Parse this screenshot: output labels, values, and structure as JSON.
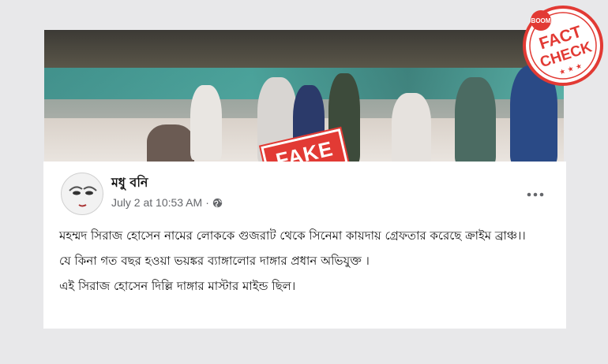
{
  "video": {
    "stamp_label": "FAKE"
  },
  "seal": {
    "top": "BOOM",
    "line1": "FACT",
    "line2": "CHECK",
    "stars": "★ ★ ★"
  },
  "post": {
    "author": "মধু বনি",
    "date": "July 2 at 10:53 AM",
    "separator": "·",
    "paragraphs": [
      "মহম্মদ  সিরাজ হোসেন  নামের লোককে গুজরাট থেকে সিনেমা কায়দায় গ্রেফতার করেছে ক্রাইম ব্রাঞ্চ।।",
      "যে কিনা  গত বছর হওয়া ভয়ঙ্কর  ব্যাঙ্গালোর দাঙ্গার প্রধান অভিযুক্ত ।",
      "এই সিরাজ হোসেন দিল্লি দাঙ্গার মাস্টার মাইন্ড ছিল।"
    ]
  },
  "colors": {
    "stamp": "#e23a34",
    "card": "#ffffff",
    "meta": "#65676b",
    "background": "#e8e8ea"
  },
  "icons": {
    "privacy": "globe-icon",
    "menu": "more-icon"
  }
}
